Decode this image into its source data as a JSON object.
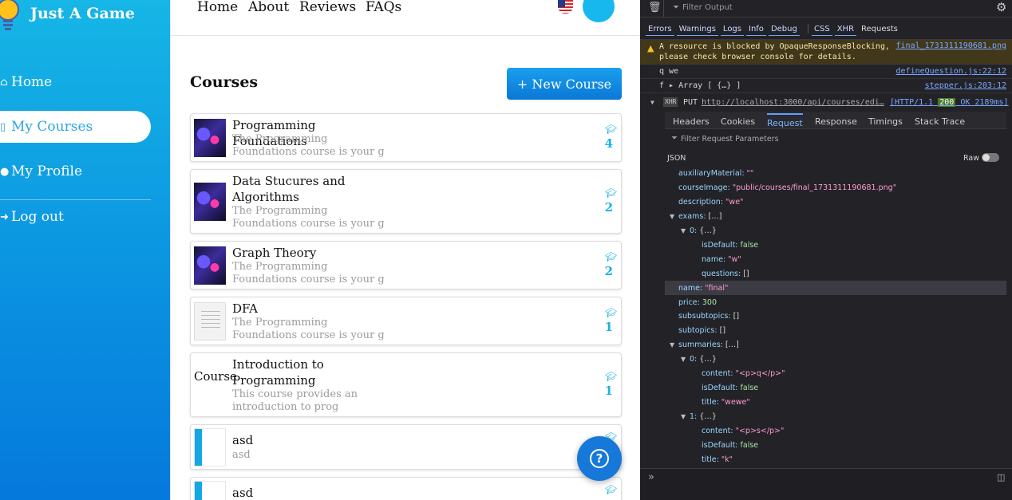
{
  "brand": {
    "name": "Just A Game"
  },
  "sidebar": {
    "items": [
      {
        "label": "Home",
        "icon": "home-icon"
      },
      {
        "label": "My Courses",
        "icon": "book-icon"
      },
      {
        "label": "My Profile",
        "icon": "user-icon"
      },
      {
        "label": "Log out",
        "icon": "logout-icon"
      }
    ]
  },
  "topnav": {
    "links": [
      "Home",
      "About",
      "Reviews",
      "FAQs"
    ]
  },
  "main": {
    "title": "Courses",
    "new_button": "+ New Course",
    "courses": [
      {
        "title": "Programming Foundations",
        "desc": "The Programming Foundations course is your g",
        "count": "4",
        "thumb": "neon"
      },
      {
        "title": "Data Stucures and Algorithms",
        "desc": "The Programming Foundations course is your g",
        "count": "2",
        "thumb": "neon"
      },
      {
        "title": "Graph Theory",
        "desc": "The Programming Foundations course is your g",
        "count": "2",
        "thumb": "neon"
      },
      {
        "title": "DFA",
        "desc": "The Programming Foundations course is your g",
        "count": "1",
        "thumb": "doc"
      },
      {
        "title": "Introduction to Programming",
        "desc": "This course provides an introduction to prog",
        "count": "1",
        "thumb": "text",
        "thumb_text": "Course"
      },
      {
        "title": "asd",
        "desc": "asd",
        "count": "",
        "thumb": "dash"
      },
      {
        "title": "asd",
        "desc": "",
        "count": "",
        "thumb": "dash"
      }
    ]
  },
  "devtools": {
    "filter_placeholder": "Filter Output",
    "filter_tabs": [
      "Errors",
      "Warnings",
      "Logs",
      "Info",
      "Debug",
      "CSS",
      "XHR",
      "Requests"
    ],
    "warning": {
      "message": "A resource is blocked by OpaqueResponseBlocking, please check browser console for details.",
      "source": "final_1731311190681.png"
    },
    "logs": [
      {
        "text": "q we",
        "source": "defineQuestion.js:22:12"
      },
      {
        "text": "f ▸ Array [ {…} ]",
        "source": "stepper.js:203:12"
      }
    ],
    "xhr": {
      "badge": "XHR",
      "method": "PUT",
      "url": "http://localhost:3000/api/courses/edi…",
      "status_prefix": "[HTTP/1.1",
      "status_code": "200",
      "status_suffix": "OK 2189ms]"
    },
    "request_tabs": [
      "Headers",
      "Cookies",
      "Request",
      "Response",
      "Timings",
      "Stack Trace"
    ],
    "filter_params": "Filter Request Parameters",
    "json_label": "JSON",
    "raw_label": "Raw",
    "json_lines": [
      "auxiliaryMaterial: \"\"",
      "courseImage: \"public/courses/final_1731311190681.png\"",
      "description: \"we\"",
      "exams: […]",
      "0: {…}",
      "isDefault: false",
      "name: \"w\"",
      "questions: []",
      "name: \"final\"",
      "price: 300",
      "subsubtopics: []",
      "subtopics: []",
      "summaries: […]",
      "0: {…}",
      "content: \"<p>q</p>\"",
      "isDefault: false",
      "title: \"wewe\"",
      "1: {…}",
      "content: \"<p>s</p>\"",
      "isDefault: false",
      "title: \"k\""
    ]
  }
}
